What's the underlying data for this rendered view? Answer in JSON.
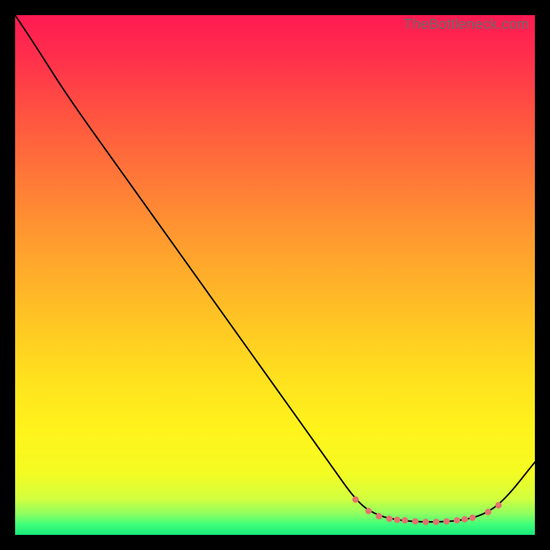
{
  "watermark": "TheBottleneck.com",
  "colors": {
    "line": "#000000",
    "dot": "#e2736e",
    "frame_bg_top": "#ff1a52",
    "frame_bg_bottom": "#17e87a",
    "page_bg": "#000000"
  },
  "chart_data": {
    "type": "line",
    "title": "",
    "xlabel": "",
    "ylabel": "",
    "xlim": [
      0,
      100
    ],
    "ylim": [
      0,
      100
    ],
    "x": [
      0,
      4,
      10,
      20,
      30,
      40,
      50,
      60,
      66,
      70,
      74,
      78,
      82,
      86,
      90,
      94,
      100
    ],
    "values": [
      100,
      94,
      84.5,
      70.5,
      56.5,
      42.5,
      28.5,
      14.5,
      6,
      3.6,
      2.8,
      2.5,
      2.5,
      2.8,
      3.8,
      6.5,
      14
    ],
    "markers": {
      "x": [
        65.5,
        68,
        70,
        72,
        73.5,
        75,
        77,
        79,
        81,
        83,
        85,
        86.5,
        88,
        91,
        93
      ],
      "y": [
        6.8,
        4.6,
        3.6,
        3.1,
        2.9,
        2.8,
        2.6,
        2.5,
        2.5,
        2.6,
        2.8,
        3.0,
        3.3,
        4.4,
        5.7
      ],
      "radius": 4.7
    }
  }
}
